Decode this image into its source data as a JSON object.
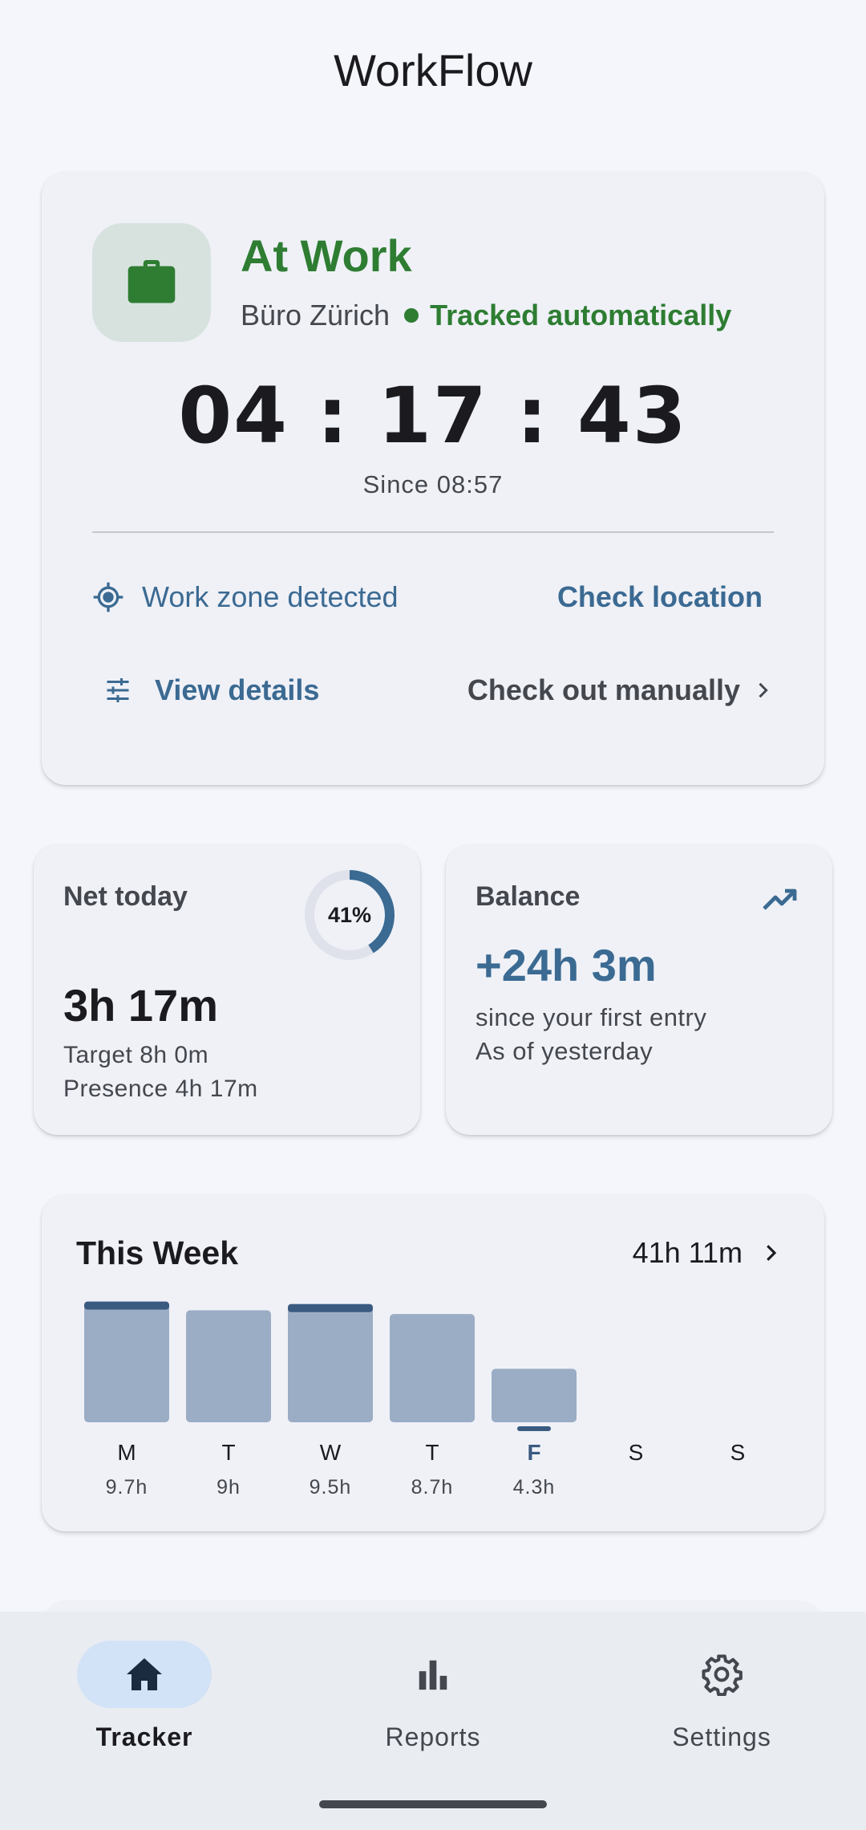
{
  "app_title": "WorkFlow",
  "status": {
    "title": "At Work",
    "location": "Büro Zürich",
    "tracked_label": "Tracked automatically",
    "timer": "04 : 17 : 43",
    "since": "Since 08:57",
    "zone_text": "Work zone detected",
    "check_location": "Check location",
    "view_details": "View details",
    "check_out": "Check out manually",
    "accent_color": "#2e7d32"
  },
  "net_today": {
    "label": "Net today",
    "value": "3h 17m",
    "progress_percent": 41,
    "progress_text": "41%",
    "target": "Target 8h 0m",
    "presence": "Presence 4h 17m"
  },
  "balance": {
    "label": "Balance",
    "value": "+24h 3m",
    "line1": "since your first entry",
    "line2": "As of yesterday"
  },
  "week": {
    "title": "This Week",
    "total": "41h 11m"
  },
  "chart_data": {
    "type": "bar",
    "categories": [
      "M",
      "T",
      "W",
      "T",
      "F",
      "S",
      "S"
    ],
    "values": [
      9.7,
      9,
      9.5,
      8.7,
      4.3,
      null,
      null
    ],
    "value_labels": [
      "9.7h",
      "9h",
      "9.5h",
      "8.7h",
      "4.3h",
      "",
      ""
    ],
    "today_index": 4,
    "target_hours": 8,
    "ylim": [
      0,
      10
    ],
    "bar_color": "#9badc5",
    "over_color": "#3b5a80"
  },
  "nav": {
    "items": [
      {
        "label": "Tracker",
        "icon": "home-icon",
        "active": true
      },
      {
        "label": "Reports",
        "icon": "bar-chart-icon",
        "active": false
      },
      {
        "label": "Settings",
        "icon": "gear-icon",
        "active": false
      }
    ]
  }
}
